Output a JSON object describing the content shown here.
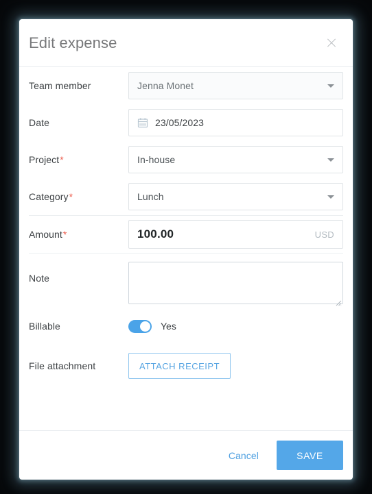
{
  "dialog": {
    "title": "Edit expense",
    "close_icon": "close-icon"
  },
  "fields": {
    "team_member": {
      "label": "Team member",
      "value": "Jenna Monet",
      "icon": "chevron-down-icon"
    },
    "date": {
      "label": "Date",
      "value": "23/05/2023",
      "icon": "calendar-icon"
    },
    "project": {
      "label": "Project",
      "required_marker": "*",
      "value": "In-house",
      "icon": "chevron-down-icon"
    },
    "category": {
      "label": "Category",
      "required_marker": "*",
      "value": "Lunch",
      "icon": "chevron-down-icon"
    },
    "amount": {
      "label": "Amount",
      "required_marker": "*",
      "value": "100.00",
      "currency": "USD"
    },
    "note": {
      "label": "Note",
      "value": "",
      "placeholder": ""
    },
    "billable": {
      "label": "Billable",
      "state_label": "Yes",
      "checked": true
    },
    "file_attachment": {
      "label": "File attachment",
      "button_label": "ATTACH RECEIPT"
    }
  },
  "footer": {
    "cancel_label": "Cancel",
    "save_label": "SAVE"
  },
  "colors": {
    "accent": "#54a7e8",
    "required": "#ec5b4b",
    "title": "#77787a",
    "border": "#dfe3e6"
  }
}
